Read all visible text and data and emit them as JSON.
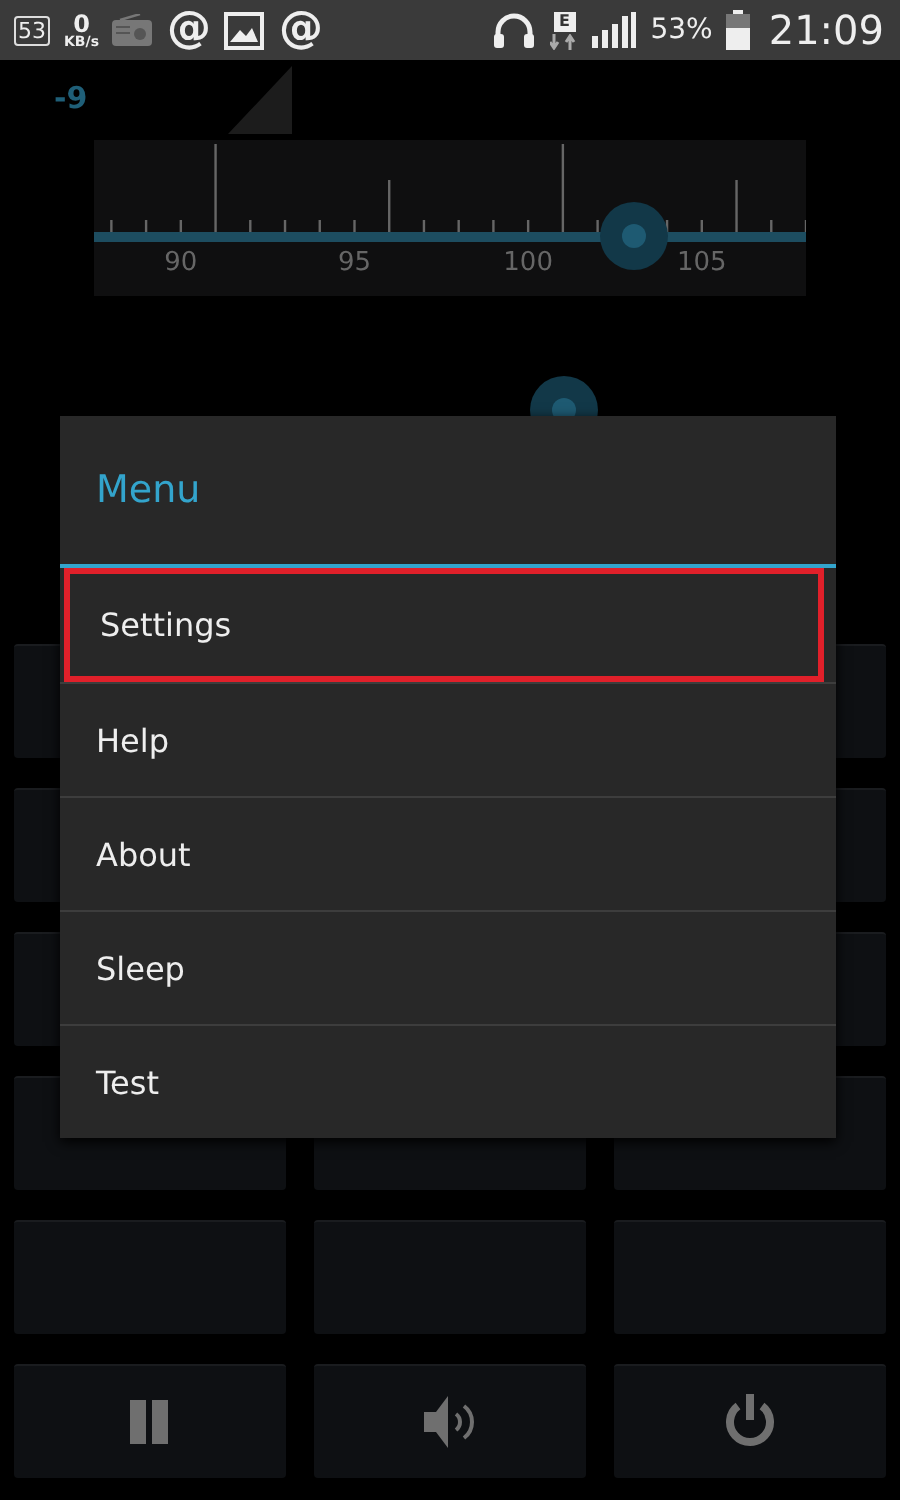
{
  "status_bar": {
    "notification_count": "53",
    "data_rate": "0",
    "data_rate_unit": "KB/s",
    "at_glyphs": [
      "@",
      "@"
    ],
    "network_type": "E",
    "battery_percent": "53%",
    "time": "21:09"
  },
  "signal_reading": "-9",
  "tuner": {
    "labels": [
      "90",
      "95",
      "100",
      "105"
    ]
  },
  "menu": {
    "title": "Menu",
    "items": [
      {
        "label": "Settings",
        "selected": true
      },
      {
        "label": "Help",
        "selected": false
      },
      {
        "label": "About",
        "selected": false
      },
      {
        "label": "Sleep",
        "selected": false
      },
      {
        "label": "Test",
        "selected": false
      }
    ]
  }
}
